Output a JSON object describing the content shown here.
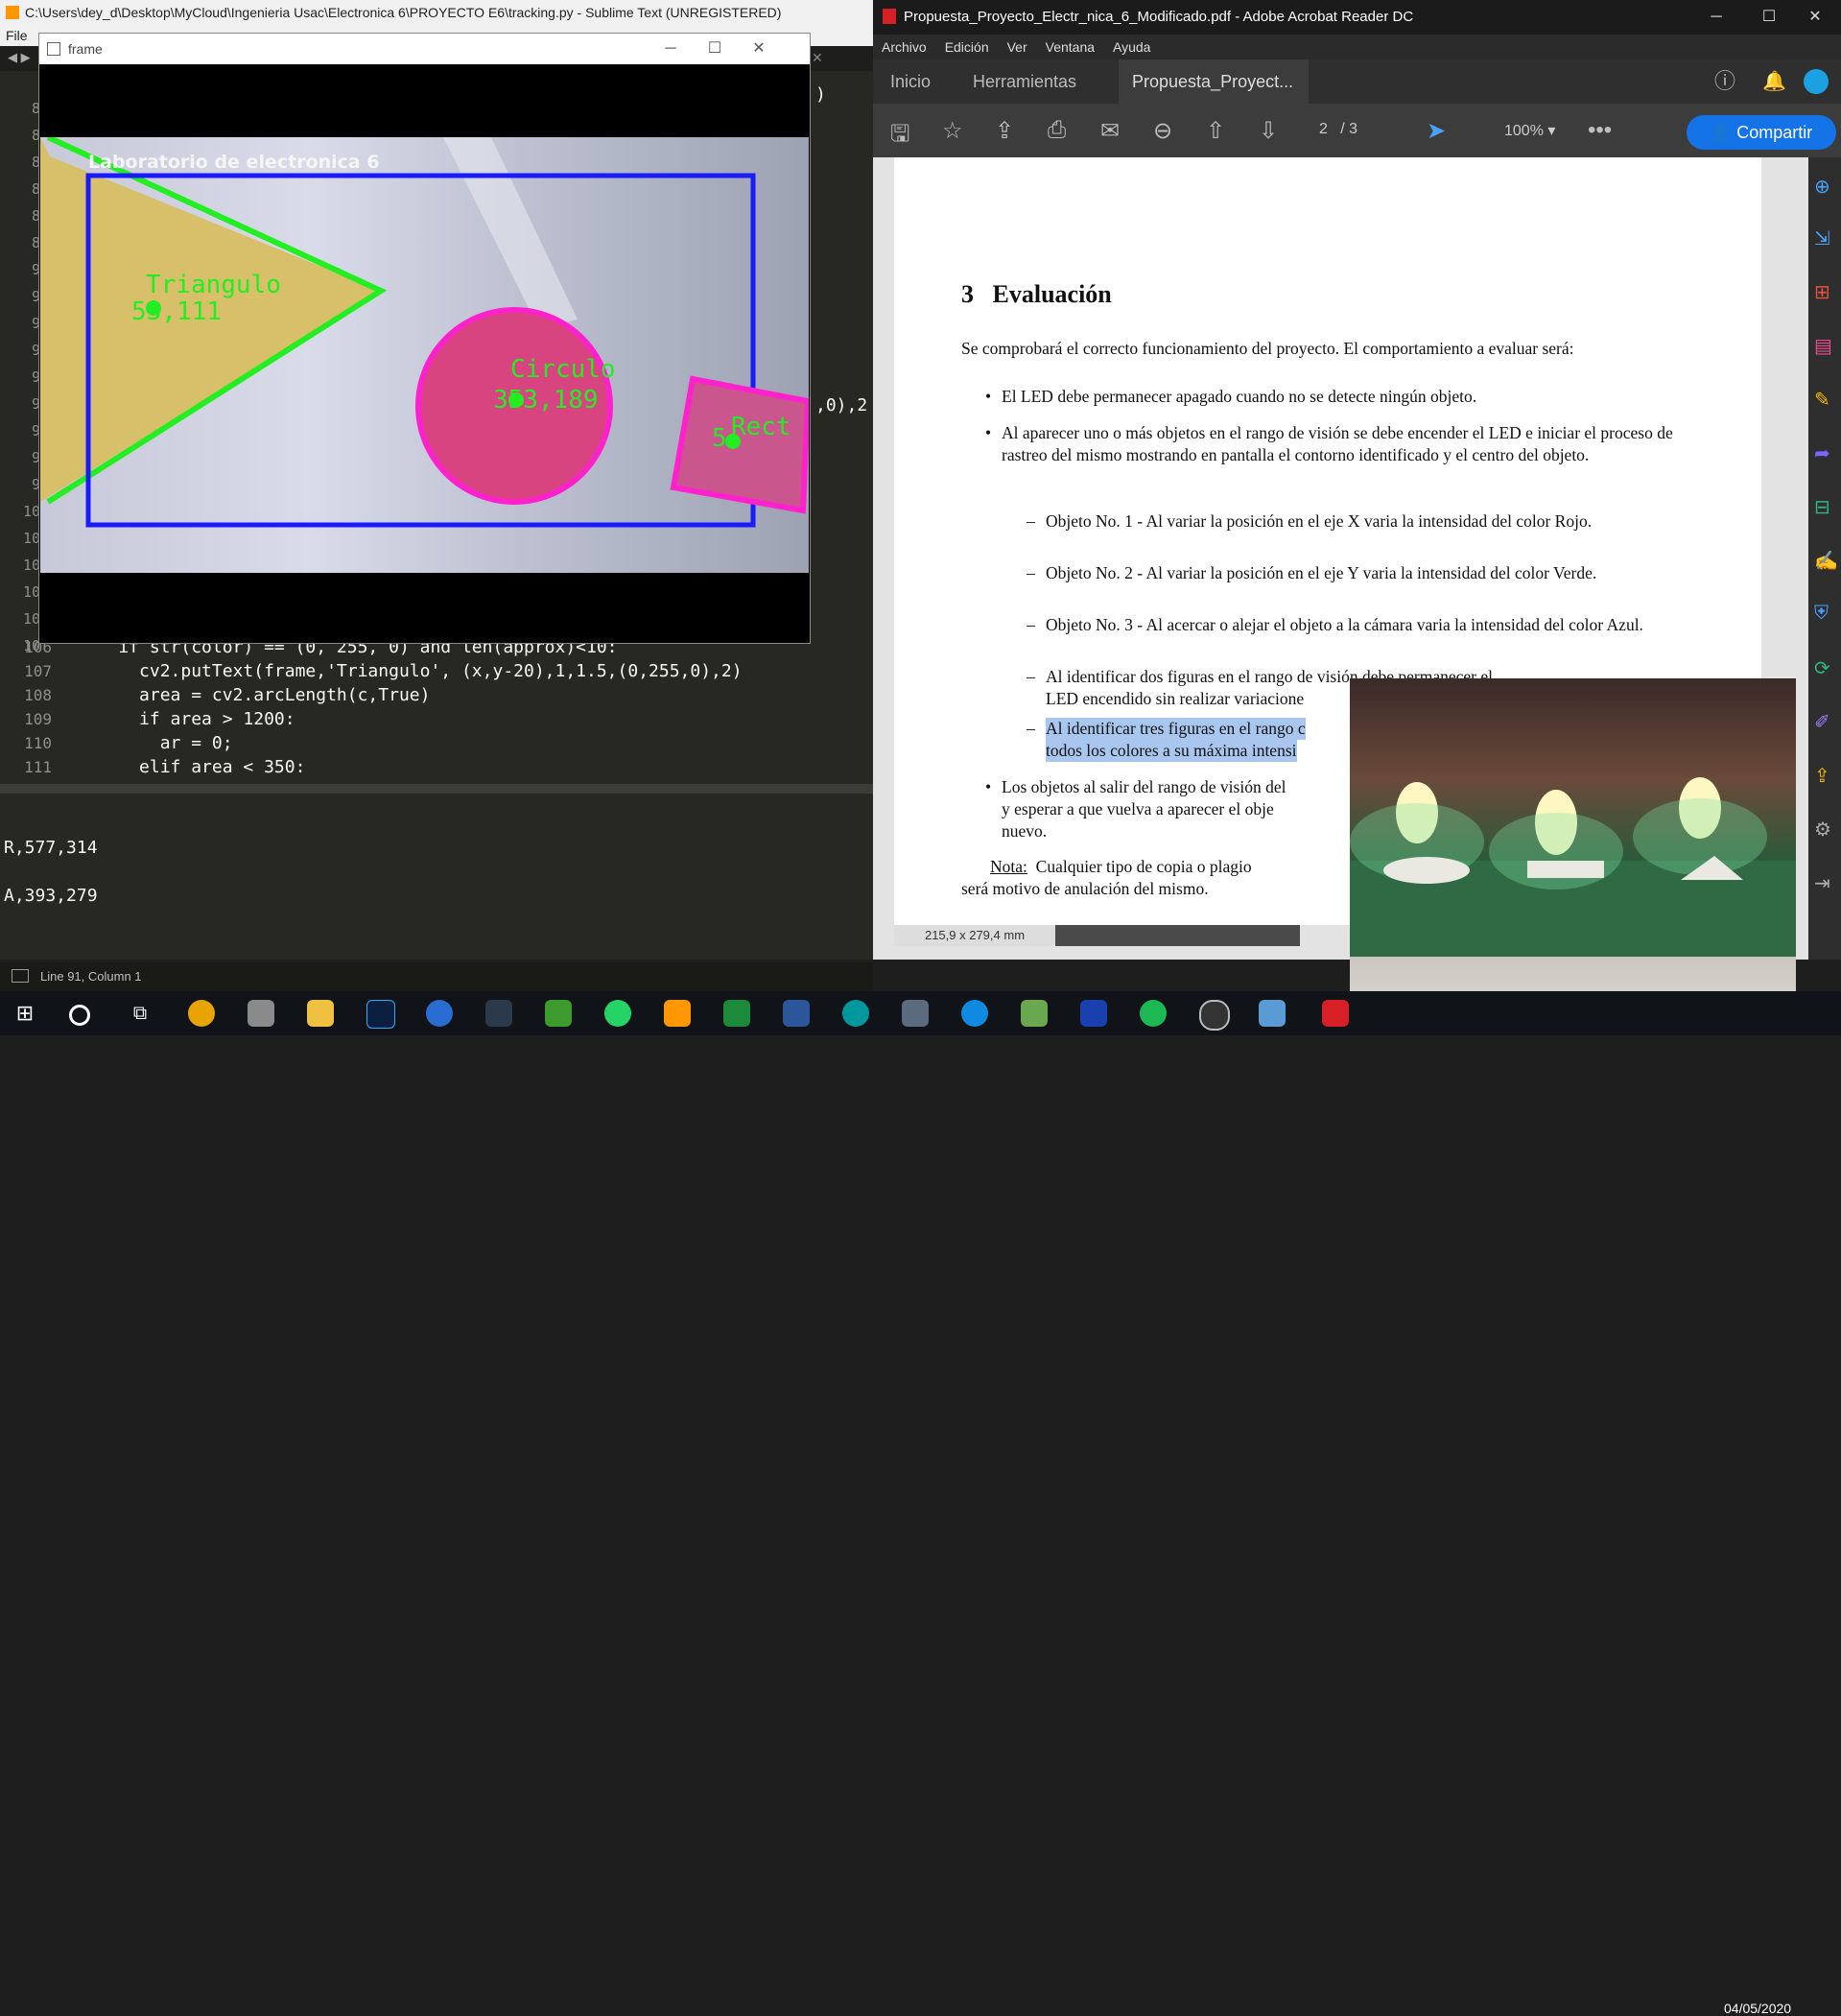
{
  "sublime": {
    "title": "C:\\Users\\dey_d\\Desktop\\MyCloud\\Ingenieria Usac\\Electronica 6\\PROYECTO E6\\tracking.py - Sublime Text (UNREGISTERED)",
    "menu_file": "File",
    "code_lines": [
      {
        "num": "106",
        "text": "    if str(color) == (0, 255, 0) and len(approx)<10:"
      },
      {
        "num": "107",
        "text": "      cv2.putText(frame,'Triangulo', (x,y-20),1,1.5,(0,255,0),2)"
      },
      {
        "num": "108",
        "text": "      area = cv2.arcLength(c,True)"
      },
      {
        "num": "109",
        "text": "      if area > 1200:"
      },
      {
        "num": "110",
        "text": "        ar = 0;"
      },
      {
        "num": "111",
        "text": "      elif area < 350:"
      }
    ],
    "code_fragment_right": ",0),2",
    "code_fragment_top": ")",
    "console_lines": [
      "R,577,314",
      "A,393,279"
    ],
    "status": "Line 91, Column 1"
  },
  "frame_window": {
    "title": "frame",
    "overlay_label": "Laboratorio de electronica 6",
    "shapes": [
      {
        "label": "Triangulo",
        "coords": "53,111"
      },
      {
        "label": "Circulo",
        "coords": "353,189"
      },
      {
        "label": "Rect",
        "coords": "5"
      }
    ]
  },
  "acrobat": {
    "title": "Propuesta_Proyecto_Electr_nica_6_Modificado.pdf - Adobe Acrobat Reader DC",
    "menu": [
      "Archivo",
      "Edición",
      "Ver",
      "Ventana",
      "Ayuda"
    ],
    "tabs": {
      "home": "Inicio",
      "tools": "Herramientas",
      "doc": "Propuesta_Proyect..."
    },
    "page_current": "2",
    "page_total": "/ 3",
    "zoom": "100%",
    "share_label": "Compartir",
    "page_size": "215,9 x 279,4 mm",
    "pdf": {
      "section_num": "3",
      "section_title": "Evaluación",
      "intro": "Se comprobará el correcto funcionamiento del proyecto. El comportamiento a evaluar será:",
      "bullet1": "El LED debe permanecer apagado cuando no se detecte ningún objeto.",
      "bullet2": "Al aparecer uno o más objetos en el rango de visión se debe encender el LED e iniciar el proceso de rastreo del mismo mostrando en pantalla el contorno identificado y el centro del objeto.",
      "sub1": "Objeto No. 1 - Al variar la posición en el eje X varia la intensidad del color Rojo.",
      "sub2": "Objeto No. 2 - Al variar la posición en el eje Y varia la intensidad del color Verde.",
      "sub3": "Objeto No. 3 - Al acercar o alejar el objeto a la cámara varia la intensidad del color Azul.",
      "sub4a": "Al identificar dos figuras en el rango de visión debe permanecer el",
      "sub4b": "LED encendido sin realizar variacione",
      "sub5a": "Al identificar tres figuras en el rango c",
      "sub5b": "todos los colores a su máxima intensi",
      "bullet3a": "Los objetos al salir del rango de visión del",
      "bullet3b": "y esperar a que vuelva a aparecer el obje",
      "bullet3c": "nuevo.",
      "nota_label": "Nota:",
      "nota_a": "Cualquier tipo de copia o plagio",
      "nota_b": "será motivo de anulación del mismo."
    }
  },
  "taskbar": {
    "date": "04/05/2020"
  }
}
